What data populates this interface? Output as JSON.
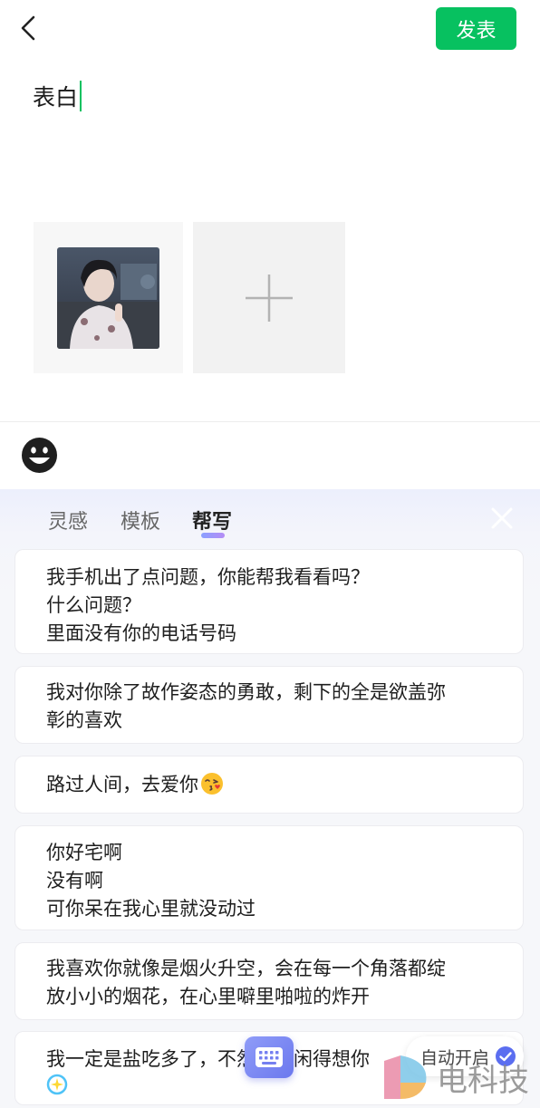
{
  "header": {
    "publish_label": "发表"
  },
  "editor": {
    "text": "表白"
  },
  "panel": {
    "tabs": [
      {
        "label": "灵感",
        "active": false
      },
      {
        "label": "模板",
        "active": false
      },
      {
        "label": "帮写",
        "active": true
      }
    ],
    "cards": [
      {
        "lines": [
          "我手机出了点问题，你能帮我看看吗？",
          "什么问题？",
          "里面没有你的电话号码"
        ]
      },
      {
        "lines": [
          "我对你除了故作姿态的勇敢，剩下的全是欲盖弥",
          "彰的喜欢"
        ]
      },
      {
        "lines": [
          "路过人间，去爱你"
        ]
      },
      {
        "lines": [
          "你好宅啊",
          "没有啊",
          "可你呆在我心里就没动过"
        ]
      },
      {
        "lines": [
          "我喜欢你就像是烟火升空，会在每一个角落都绽",
          "放小小的烟花，在心里噼里啪啦的炸开"
        ]
      },
      {
        "lines": [
          "我一定是盐吃多了，不然怎么闲得想你"
        ]
      }
    ],
    "autostart_label": "自动开启"
  },
  "watermark": {
    "text": "电科技"
  },
  "colors": {
    "accent_green": "#07c160",
    "panel_accent": "#7b86f2"
  },
  "icons": {
    "back": "chevron-left-icon",
    "add": "plus-icon",
    "emoji": "smiley-icon",
    "close": "close-icon",
    "keyboard": "keyboard-icon",
    "check": "check-circle-icon"
  }
}
